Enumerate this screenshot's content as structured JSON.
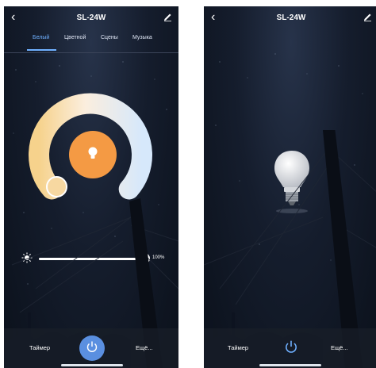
{
  "left": {
    "title": "SL-24W",
    "tabs": [
      "Белый",
      "Цветной",
      "Сцены",
      "Музыка"
    ],
    "active_tab": "Белый",
    "brightness": {
      "percent_label": "100%",
      "level": 1.0
    },
    "timer_label": "Таймер",
    "more_label": "Ещё...",
    "power": "on"
  },
  "right": {
    "title": "SL-24W",
    "timer_label": "Таймер",
    "more_label": "Ещё...",
    "power": "off"
  },
  "colors": {
    "accent": "#6fb0ff",
    "warm_center": "#f49a44",
    "power_active": "#5a8fe0"
  },
  "icons": [
    "back-icon",
    "edit-icon",
    "bulb-icon",
    "sun-icon",
    "power-icon"
  ]
}
